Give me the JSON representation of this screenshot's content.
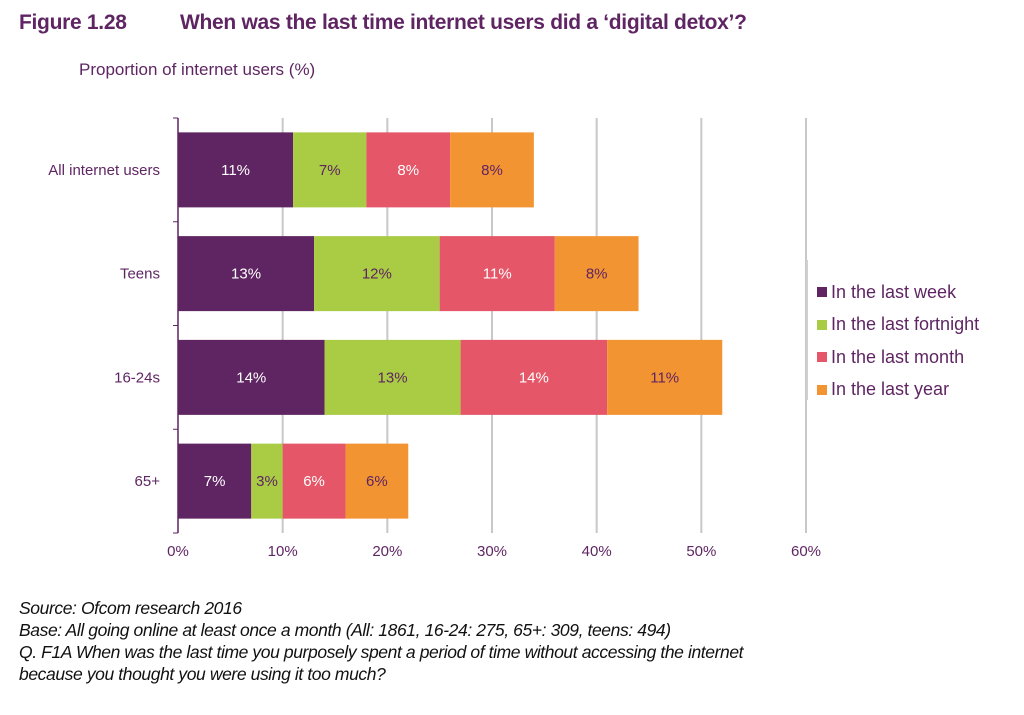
{
  "figure": {
    "number": "Figure 1.28",
    "title": "When was the last time internet users did a ‘digital detox’?"
  },
  "chart_data": {
    "type": "bar",
    "orientation": "horizontal",
    "stacked": true,
    "title": "When was the last time internet users did a ‘digital detox’?",
    "xlabel": "",
    "ylabel": "Proportion of internet users (%)",
    "xlim": [
      0,
      60
    ],
    "x_ticks": [
      0,
      10,
      20,
      30,
      40,
      50,
      60
    ],
    "x_tick_labels": [
      "0%",
      "10%",
      "20%",
      "30%",
      "40%",
      "50%",
      "60%"
    ],
    "grid": true,
    "legend_position": "right",
    "categories": [
      "All internet users",
      "Teens",
      "16-24s",
      "65+"
    ],
    "series": [
      {
        "name": "In the last week",
        "color": "#5f2462",
        "label_color": "#ffffff",
        "values": [
          11,
          13,
          14,
          7
        ],
        "labels": [
          "11%",
          "13%",
          "14%",
          "7%"
        ]
      },
      {
        "name": "In the last fortnight",
        "color": "#a9cc44",
        "label_color": "#5f2462",
        "values": [
          7,
          12,
          13,
          3
        ],
        "labels": [
          "7%",
          "12%",
          "13%",
          "3%"
        ]
      },
      {
        "name": "In the last month",
        "color": "#e45668",
        "label_color": "#ffffff",
        "values": [
          8,
          11,
          14,
          6
        ],
        "labels": [
          "8%",
          "11%",
          "14%",
          "6%"
        ]
      },
      {
        "name": "In the last year",
        "color": "#f39433",
        "label_color": "#5f2462",
        "values": [
          8,
          8,
          11,
          6
        ],
        "labels": [
          "8%",
          "8%",
          "11%",
          "6%"
        ]
      }
    ]
  },
  "footer": {
    "source": "Source: Ofcom research 2016",
    "base": "Base: All going online at least once a month (All: 1861, 16-24: 275, 65+: 309, teens: 494)",
    "question_line1": "Q. F1A When was the last time you purposely spent a period of time without accessing the internet",
    "question_line2": "because you thought you were using it too much?"
  }
}
